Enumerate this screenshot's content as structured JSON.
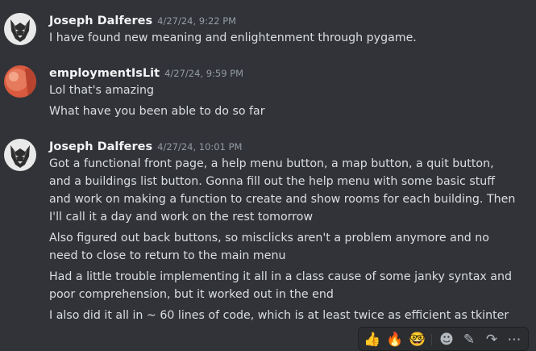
{
  "messages": [
    {
      "author": "Joseph Dalferes",
      "timestamp": "4/27/24, 9:22 PM",
      "avatar": "wolf-avatar",
      "lines": [
        "I have found new meaning and enlightenment through pygame."
      ]
    },
    {
      "author": "employmentIsLit",
      "timestamp": "4/27/24, 9:59 PM",
      "avatar": "orange-avatar",
      "lines": [
        "Lol that's amazing",
        "What have you been able to do so far"
      ]
    },
    {
      "author": "Joseph Dalferes",
      "timestamp": "4/27/24, 10:01 PM",
      "avatar": "wolf-avatar",
      "lines": [
        "Got a functional front page, a help menu button, a map button, a quit button, and a buildings list button. Gonna fill out the help menu with some basic stuff and work on making a function to create and show rooms for each building. Then I'll call it a day and work on the rest tomorrow",
        "Also figured out back buttons, so misclicks aren't a problem anymore and no need to close to return to the main menu",
        "Had a little trouble implementing it all in a class cause of some janky syntax and poor comprehension, but it worked out in the end",
        "I also did it all in ~ 60 lines of code, which is at least twice as efficient as tkinter"
      ]
    }
  ],
  "toolbar": {
    "reactions": [
      "👍",
      "🔥",
      "🤓"
    ],
    "actions": [
      {
        "name": "add-reaction-icon",
        "glyph": "☻"
      },
      {
        "name": "edit-icon",
        "glyph": "✎"
      },
      {
        "name": "forward-icon",
        "glyph": "↷"
      },
      {
        "name": "more-icon",
        "glyph": "⋯"
      }
    ]
  },
  "colors": {
    "background": "#313338",
    "username": "#f2f3f5",
    "timestamp": "#949ba4",
    "text": "#dbdee1"
  }
}
